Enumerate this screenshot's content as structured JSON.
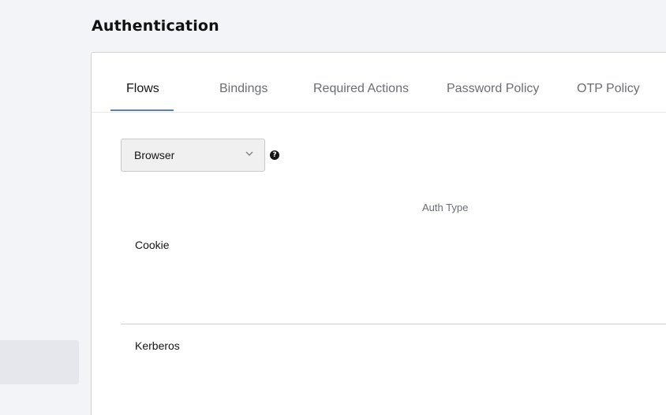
{
  "page": {
    "title": "Authentication"
  },
  "tabs": [
    {
      "label": "Flows",
      "active": true
    },
    {
      "label": "Bindings",
      "active": false
    },
    {
      "label": "Required Actions",
      "active": false
    },
    {
      "label": "Password Policy",
      "active": false
    },
    {
      "label": "OTP Policy",
      "active": false
    }
  ],
  "flow_select": {
    "value": "Browser",
    "icon": "chevron-down-icon"
  },
  "help": {
    "icon": "question-circle-icon",
    "glyph": "?"
  },
  "table": {
    "column_header": "Auth Type",
    "rows": [
      {
        "auth_type": "Cookie"
      },
      {
        "auth_type": "Kerberos"
      }
    ]
  },
  "colors": {
    "accent": "#5b7fc7",
    "background": "#f3f4f8",
    "panel": "#ffffff"
  }
}
